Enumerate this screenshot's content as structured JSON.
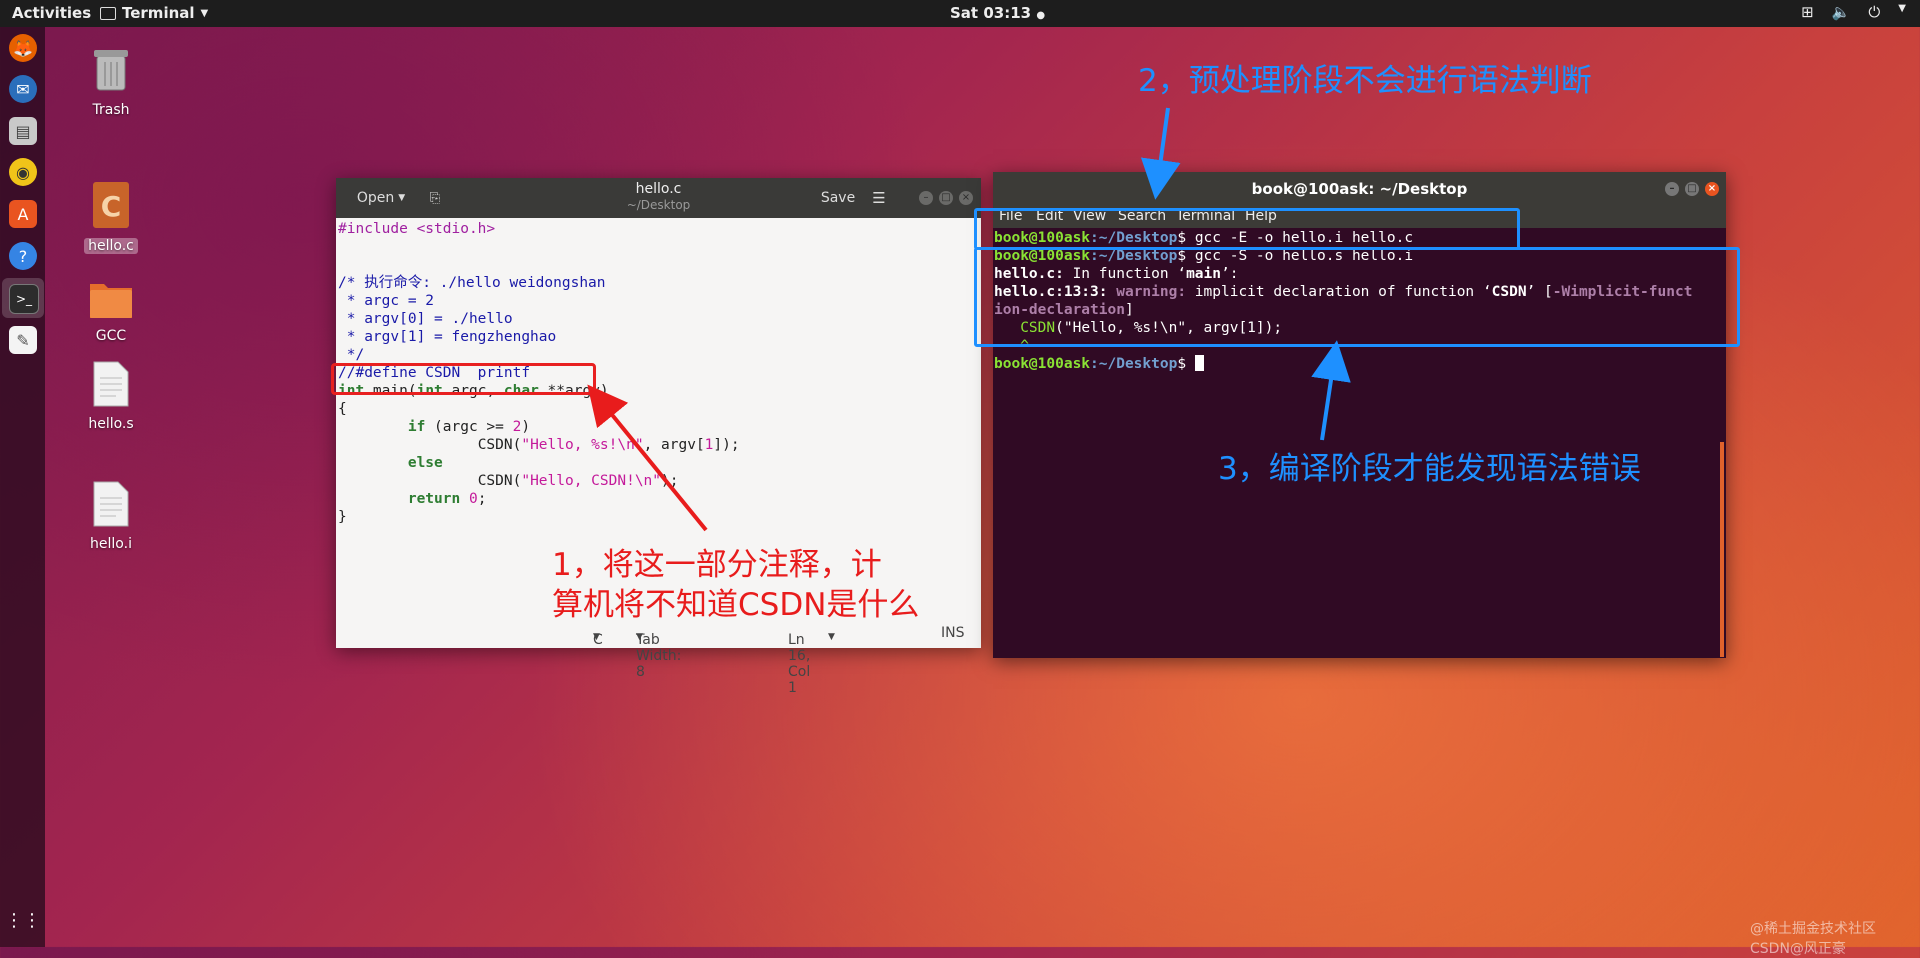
{
  "topbar": {
    "activities": "Activities",
    "app_menu": "Terminal",
    "clock": "Sat 03:13"
  },
  "dock": {
    "items": [
      "firefox-icon",
      "thunderbird-icon",
      "files-icon",
      "rhythmbox-icon",
      "software-icon",
      "help-icon",
      "terminal-icon",
      "text-editor-icon"
    ],
    "show_apps_icon": "grid-icon"
  },
  "desktop": {
    "icons": [
      {
        "label": "Trash"
      },
      {
        "label": "hello.c"
      },
      {
        "label": "GCC"
      },
      {
        "label": "hello.s"
      },
      {
        "label": "hello.i"
      }
    ]
  },
  "gedit": {
    "open_label": "Open",
    "title": "hello.c",
    "subtitle": "~/Desktop",
    "save_label": "Save",
    "code": {
      "l1": "#include <stdio.h>",
      "l4": "/* 执行命令: ./hello weidongshan",
      "l5": " * argc = 2",
      "l6": " * argv[0] = ./hello",
      "l7": " * argv[1] = fengzhenghao",
      "l8": " */",
      "l9": "//#define CSDN  printf",
      "l10a": "int",
      "l10b": " main(",
      "l10c": "int",
      "l10d": " argc, ",
      "l10e": "char",
      "l10f": " **argv)",
      "l11": "{",
      "l12a": "if",
      "l12b": " (argc >= ",
      "l12c": "2",
      "l12d": ")",
      "l13a": "CSDN(",
      "l13b": "\"Hello, %s!\\n\"",
      "l13c": ", argv[",
      "l13d": "1",
      "l13e": "]);",
      "l14": "else",
      "l15a": "CSDN(",
      "l15b": "\"Hello, CSDN!\\n\"",
      "l15c": ");",
      "l16a": "return",
      "l16b": " ",
      "l16c": "0",
      "l16d": ";",
      "l17": "}"
    },
    "status": {
      "language": "C",
      "tab_width": "Tab Width: 8",
      "position": "Ln 16, Col 1",
      "mode": "INS"
    }
  },
  "terminal": {
    "title": "book@100ask: ~/Desktop",
    "menu": [
      "File",
      "Edit",
      "View",
      "Search",
      "Terminal",
      "Help"
    ],
    "prompt_user": "book@100ask",
    "prompt_path": ":~/Desktop",
    "prompt_sym": "$ ",
    "cmd1": "gcc -E -o hello.i hello.c",
    "cmd2": "gcc -S -o hello.s hello.i",
    "out1a": "hello.c:",
    "out1b": " In function ‘",
    "out1c": "main",
    "out1d": "’:",
    "out2a": "hello.c:13:3:",
    "out2b": " warning:",
    "out2c": " implicit declaration of function ‘",
    "out2d": "CSDN",
    "out2e": "’ [",
    "out2f": "-Wimplicit-funct",
    "out3a": "ion-declaration",
    "out3b": "]",
    "out4a": "   ",
    "out4b": "CSDN",
    "out4c": "(\"Hello, %s!\\n\", argv[1]);",
    "out5": "   ^~~~"
  },
  "annotations": {
    "a1_line1": "1，将这一部分注释，计",
    "a1_line2": "算机将不知道CSDN是什么",
    "a2": "2，预处理阶段不会进行语法判断",
    "a3": "3，编译阶段才能发现语法错误"
  },
  "watermark": "@稀土掘金技术社区  CSDN@风正豪",
  "colors": {
    "annotation_red": "#e81c1c",
    "annotation_blue": "#1e90ff",
    "terminal_bg": "#300a24",
    "prompt_green": "#8ae234",
    "prompt_blue": "#729fcf"
  }
}
